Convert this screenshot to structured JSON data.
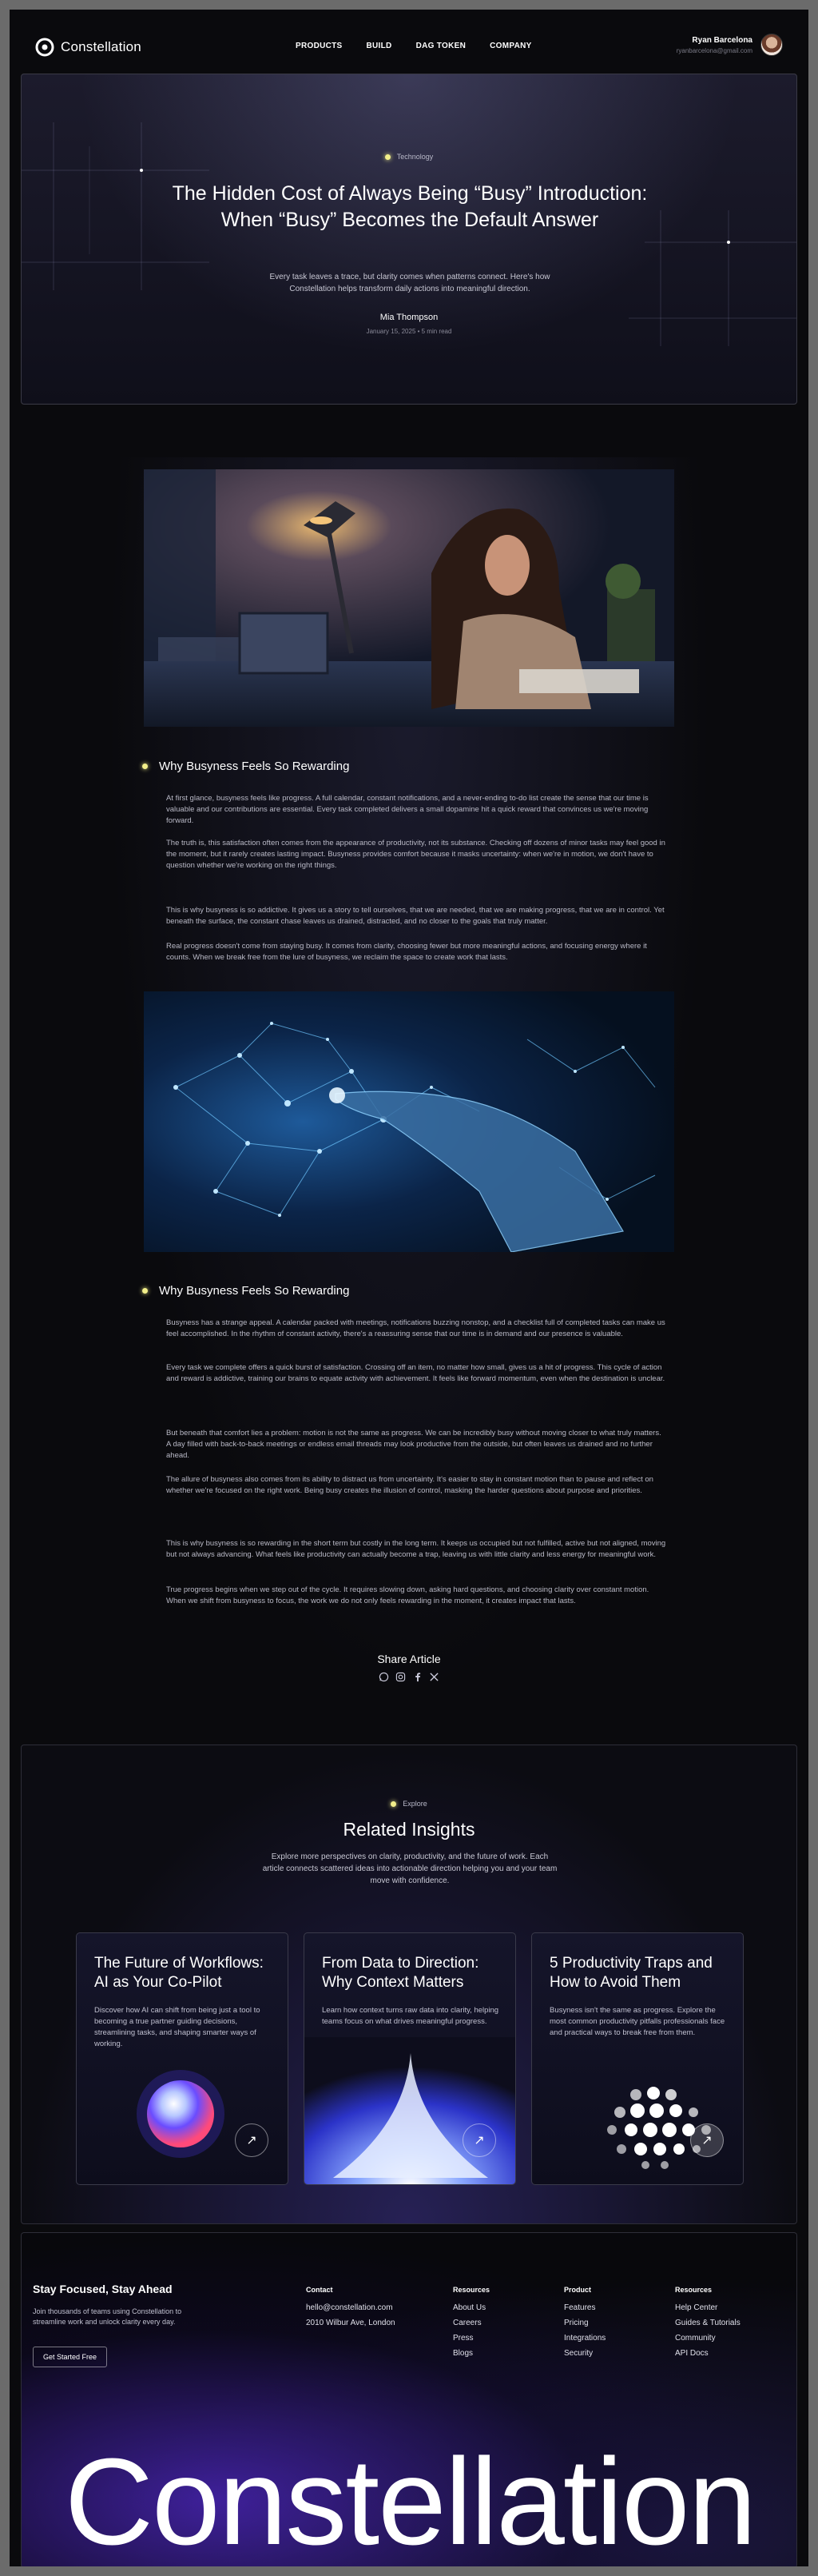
{
  "nav": {
    "logo_text": "Constellation",
    "links": [
      "PRODUCTS",
      "BUILD",
      "DAG TOKEN",
      "COMPANY"
    ],
    "user_name": "Ryan Barcelona",
    "user_email": "ryanbarcelona@gmail.com"
  },
  "hero": {
    "tag": "Technology",
    "title": "The Hidden Cost of Always Being “Busy” Introduction: When “Busy” Becomes the Default Answer",
    "subtitle": "Every task leaves a trace, but clarity comes when patterns connect. Here's how Constellation helps transform daily actions into meaningful direction.",
    "author": "Mia Thompson",
    "meta": "January 15, 2025 • 5 min read"
  },
  "article": {
    "section1": {
      "heading": "Why Busyness Feels So Rewarding",
      "paragraphs": [
        "At first glance, busyness feels like progress. A full calendar, constant notifications, and a never-ending to-do list create the sense that our time is valuable and our contributions are essential. Every task completed delivers a small dopamine hit a quick reward that convinces us we're moving forward.",
        "The truth is, this satisfaction often comes from the appearance of productivity, not its substance. Checking off dozens of minor tasks may feel good in the moment, but it rarely creates lasting impact. Busyness provides comfort because it masks uncertainty: when we're in motion, we don't have to question whether we're working on the right things.",
        "This is why busyness is so addictive. It gives us a story to tell ourselves, that we are needed, that we are making progress, that we are in control. Yet beneath the surface, the constant chase leaves us drained, distracted, and no closer to the goals that truly matter.",
        "Real progress doesn't come from staying busy. It comes from clarity, choosing fewer but more meaningful actions, and focusing energy where it counts. When we break free from the lure of busyness, we reclaim the space to create work that lasts."
      ]
    },
    "section2": {
      "heading": "Why Busyness Feels So Rewarding",
      "paragraphs": [
        "Busyness has a strange appeal. A calendar packed with meetings, notifications buzzing nonstop, and a checklist full of completed tasks can make us feel accomplished. In the rhythm of constant activity, there's a reassuring sense that our time is in demand and our presence is valuable.",
        "Every task we complete offers a quick burst of satisfaction. Crossing off an item, no matter how small, gives us a hit of progress. This cycle of action and reward is addictive, training our brains to equate activity with achievement. It feels like forward momentum, even when the destination is unclear.",
        "But beneath that comfort lies a problem: motion is not the same as progress. We can be incredibly busy without moving closer to what truly matters. A day filled with back-to-back meetings or endless email threads may look productive from the outside, but often leaves us drained and no further ahead.",
        "The allure of busyness also comes from its ability to distract us from uncertainty. It's easier to stay in constant motion than to pause and reflect on whether we're focused on the right work. Being busy creates the illusion of control, masking the harder questions about purpose and priorities.",
        "This is why busyness is so rewarding in the short term but costly in the long term. It keeps us occupied but not fulfilled, active but not aligned, moving but not always advancing. What feels like productivity can actually become a trap, leaving us with little clarity and less energy for meaningful work.",
        "True progress begins when we step out of the cycle. It requires slowing down, asking hard questions, and choosing clarity over constant motion. When we shift from busyness to focus, the work we do not only feels rewarding in the moment, it creates impact that lasts."
      ]
    }
  },
  "share": {
    "title": "Share Article",
    "icons": [
      "whatsapp-icon",
      "instagram-icon",
      "facebook-icon",
      "x-icon"
    ]
  },
  "related": {
    "tag": "Explore",
    "title": "Related Insights",
    "subtitle": "Explore more perspectives on clarity, productivity, and the future of work. Each article connects scattered ideas into actionable direction helping you and your team move with confidence.",
    "cards": [
      {
        "title": "The Future of Workflows: AI as Your Co-Pilot",
        "desc": "Discover how AI can shift from being just a tool to becoming a true partner guiding decisions, streamlining tasks, and shaping smarter ways of working."
      },
      {
        "title": "From Data to Direction: Why Context Matters",
        "desc": "Learn how context turns raw data into clarity, helping teams focus on what drives meaningful progress."
      },
      {
        "title": "5 Productivity Traps and How to Avoid Them",
        "desc": "Busyness isn't the same as progress. Explore the most common productivity pitfalls professionals face and practical ways to break free from them."
      }
    ]
  },
  "footer": {
    "title": "Stay Focused, Stay Ahead",
    "subtitle": "Join thousands of teams using Constellation to streamline work and unlock clarity every day.",
    "button": "Get Started Free",
    "contact": {
      "head": "Contact",
      "items": [
        "hello@constellation.com",
        "2010 Wilbur Ave, London"
      ]
    },
    "resources1": {
      "head": "Resources",
      "items": [
        "About Us",
        "Careers",
        "Press",
        "Blogs"
      ]
    },
    "product": {
      "head": "Product",
      "items": [
        "Features",
        "Pricing",
        "Integrations",
        "Security"
      ]
    },
    "resources2": {
      "head": "Resources",
      "items": [
        "Help Center",
        "Guides & Tutorials",
        "Community",
        "API Docs"
      ]
    },
    "brand": "Constellation"
  }
}
